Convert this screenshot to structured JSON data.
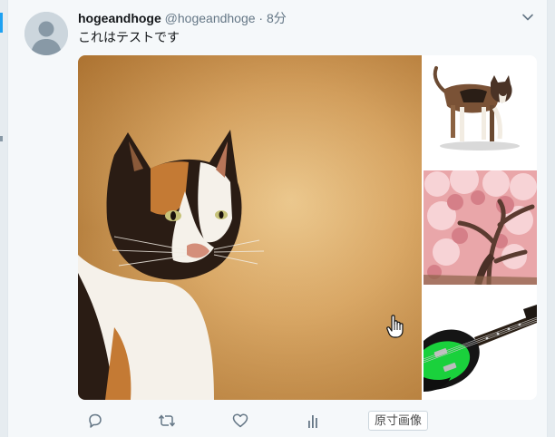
{
  "tweet": {
    "display_name": "hogeandhoge",
    "handle": "@hogeandhoge",
    "separator": "·",
    "time": "8分",
    "text": "これはテストです"
  },
  "actions": {
    "original_image_label": "原寸画像"
  },
  "icons": {
    "avatar": "default-avatar-icon",
    "chevron": "chevron-down-icon",
    "reply": "reply-icon",
    "retweet": "retweet-icon",
    "like": "heart-icon",
    "analytics": "analytics-icon",
    "cursor": "hand-pointer-cursor"
  },
  "media": [
    {
      "subject": "calico-cat-portrait"
    },
    {
      "subject": "calico-cat-walking"
    },
    {
      "subject": "cherry-blossom-tree"
    },
    {
      "subject": "green-electric-guitar"
    }
  ],
  "colors": {
    "accent": "#1da1f2",
    "text": "#14171a",
    "muted": "#657786",
    "background": "#f5f8fa"
  }
}
